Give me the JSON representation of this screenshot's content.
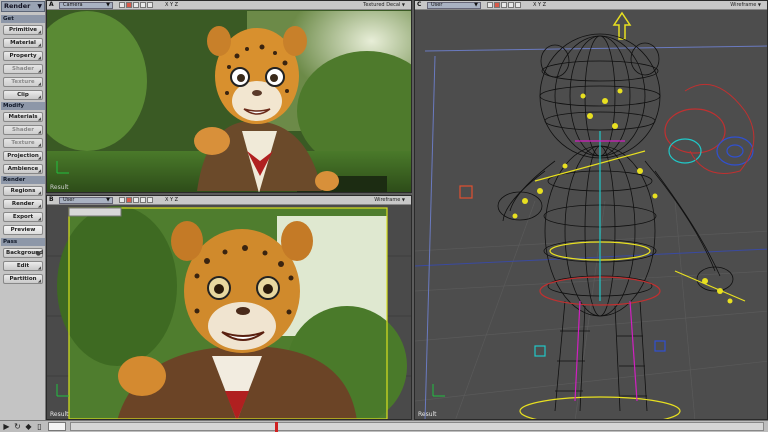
{
  "panel": {
    "mode": "Render",
    "sections": [
      {
        "key": "get",
        "label": "Get"
      },
      {
        "key": "modify",
        "label": "Modify"
      },
      {
        "key": "render",
        "label": "Render"
      },
      {
        "key": "pass",
        "label": "Pass"
      }
    ],
    "buttons": {
      "primitive": "Primitive",
      "material": "Material",
      "property": "Property",
      "shader": "Shader",
      "texture": "Texture",
      "clip": "Clip",
      "materials": "Materials",
      "shader2": "Shader",
      "texture2": "Texture",
      "projection": "Projection",
      "ambience": "Ambience",
      "regions": "Regions",
      "render": "Render",
      "export": "Export",
      "preview": "Preview",
      "background": "Background",
      "edit": "Edit",
      "partition": "Partition"
    }
  },
  "viewports": {
    "a": {
      "letter": "A",
      "camera": "Camera",
      "axes": "X Y Z",
      "mode": "Textured Decal",
      "result": "Result"
    },
    "b": {
      "letter": "B",
      "camera": "User",
      "axes": "X Y Z",
      "mode": "Wireframe",
      "result": "Result"
    },
    "c": {
      "letter": "C",
      "camera": "User",
      "axes": "X Y Z",
      "mode": "Wireframe",
      "result": "Result"
    }
  },
  "colors": {
    "panel": "#c4c4c4",
    "section_header": "#8d97a8",
    "viewport_bg_wireframe": "#4d4d4d",
    "timeline_marker": "#d02020",
    "wire_mesh": "#101010",
    "rig_yellow": "#e8e020",
    "rig_cyan": "#20c8c8",
    "rig_magenta": "#d020c0"
  },
  "icons": [
    "dropdown-arrow-icon",
    "viewport-tool-icon",
    "play-icon",
    "loop-icon",
    "key-icon",
    "timeline-marker"
  ]
}
